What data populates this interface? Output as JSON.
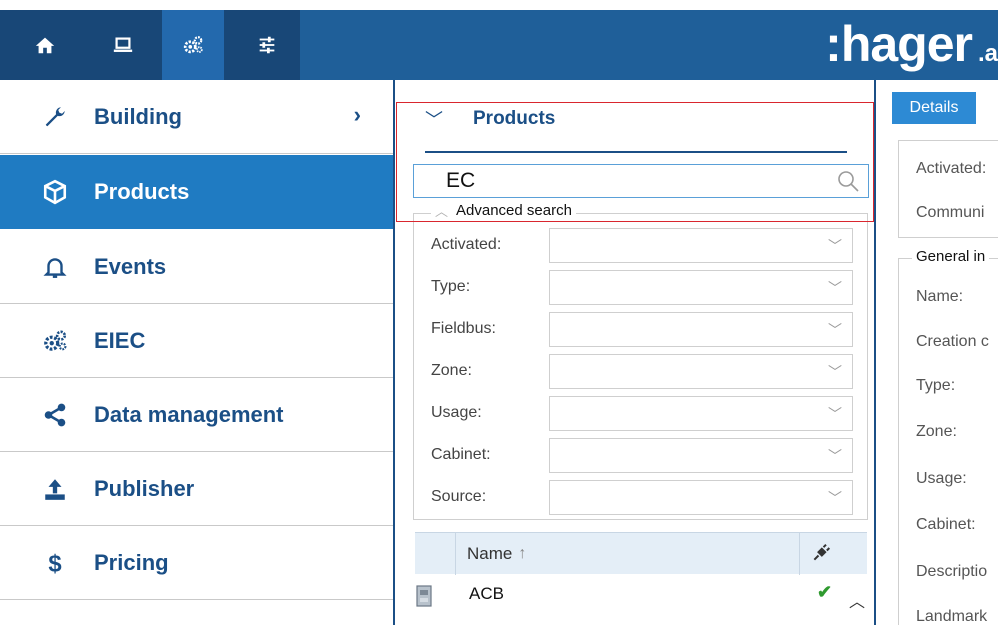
{
  "topbar": {
    "logo_main": ":hager",
    "logo_suffix": ".a"
  },
  "sidebar": {
    "items": [
      {
        "label": "Building",
        "icon": "wrench-icon",
        "active": false,
        "has_chevron": true,
        "chevron": "›"
      },
      {
        "label": "Products",
        "icon": "cube-icon",
        "active": true
      },
      {
        "label": "Events",
        "icon": "bell-icon",
        "active": false
      },
      {
        "label": "EIEC",
        "icon": "gears-icon",
        "active": false
      },
      {
        "label": "Data management",
        "icon": "share-icon",
        "active": false
      },
      {
        "label": "Publisher",
        "icon": "upload-icon",
        "active": false
      },
      {
        "label": "Pricing",
        "icon": "dollar-icon",
        "active": false
      }
    ]
  },
  "products": {
    "title": "Products",
    "chevron": "﹀",
    "search_value": "EC",
    "advanced_search_label": "Advanced search",
    "filters": [
      {
        "label": "Activated:",
        "value": ""
      },
      {
        "label": "Type:",
        "value": ""
      },
      {
        "label": "Fieldbus:",
        "value": ""
      },
      {
        "label": "Zone:",
        "value": ""
      },
      {
        "label": "Usage:",
        "value": ""
      },
      {
        "label": "Cabinet:",
        "value": ""
      },
      {
        "label": "Source:",
        "value": ""
      }
    ],
    "grid": {
      "col_name": "Name",
      "sort_indicator": "↑",
      "rows": [
        {
          "name": "ACB",
          "check": "✔"
        }
      ]
    }
  },
  "details": {
    "button_label": "Details",
    "top_fields": [
      "Activated:",
      "Communi"
    ],
    "general_legend": "General in",
    "general_fields": [
      "Name:",
      "Creation c",
      "Type:",
      "Zone:",
      "Usage:",
      "Cabinet:",
      "Descriptio",
      "Landmark"
    ]
  },
  "colors": {
    "brand_blue": "#1f5f99",
    "active_blue": "#1f7bc2",
    "nav_text": "#1b4f86",
    "highlight_red": "#d9262e"
  }
}
